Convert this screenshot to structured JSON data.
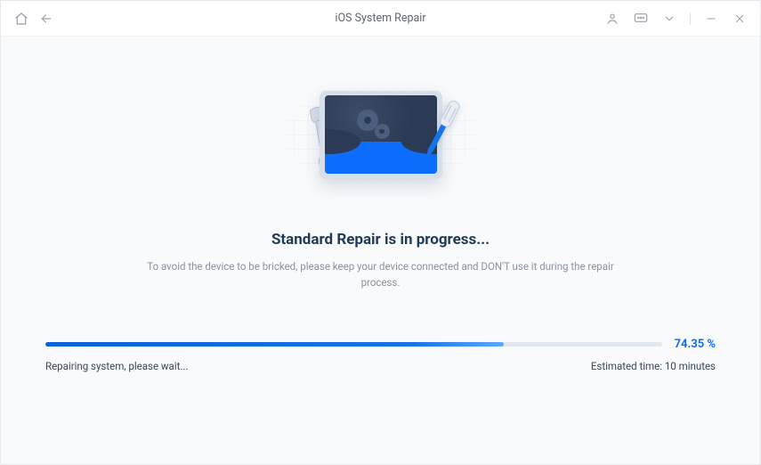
{
  "titlebar": {
    "title": "iOS System Repair"
  },
  "main": {
    "heading": "Standard Repair is in progress...",
    "subtext": "To avoid the device to be bricked, please keep your device connected and DON'T use it during the repair process."
  },
  "progress": {
    "percent_value": 74.35,
    "percent_label": "74.35 %",
    "fill_width_style": "width:74.35%",
    "status_text": "Repairing system, please wait...",
    "estimated_label": "Estimated time: 10 minutes"
  },
  "colors": {
    "accent": "#0d6efd"
  }
}
